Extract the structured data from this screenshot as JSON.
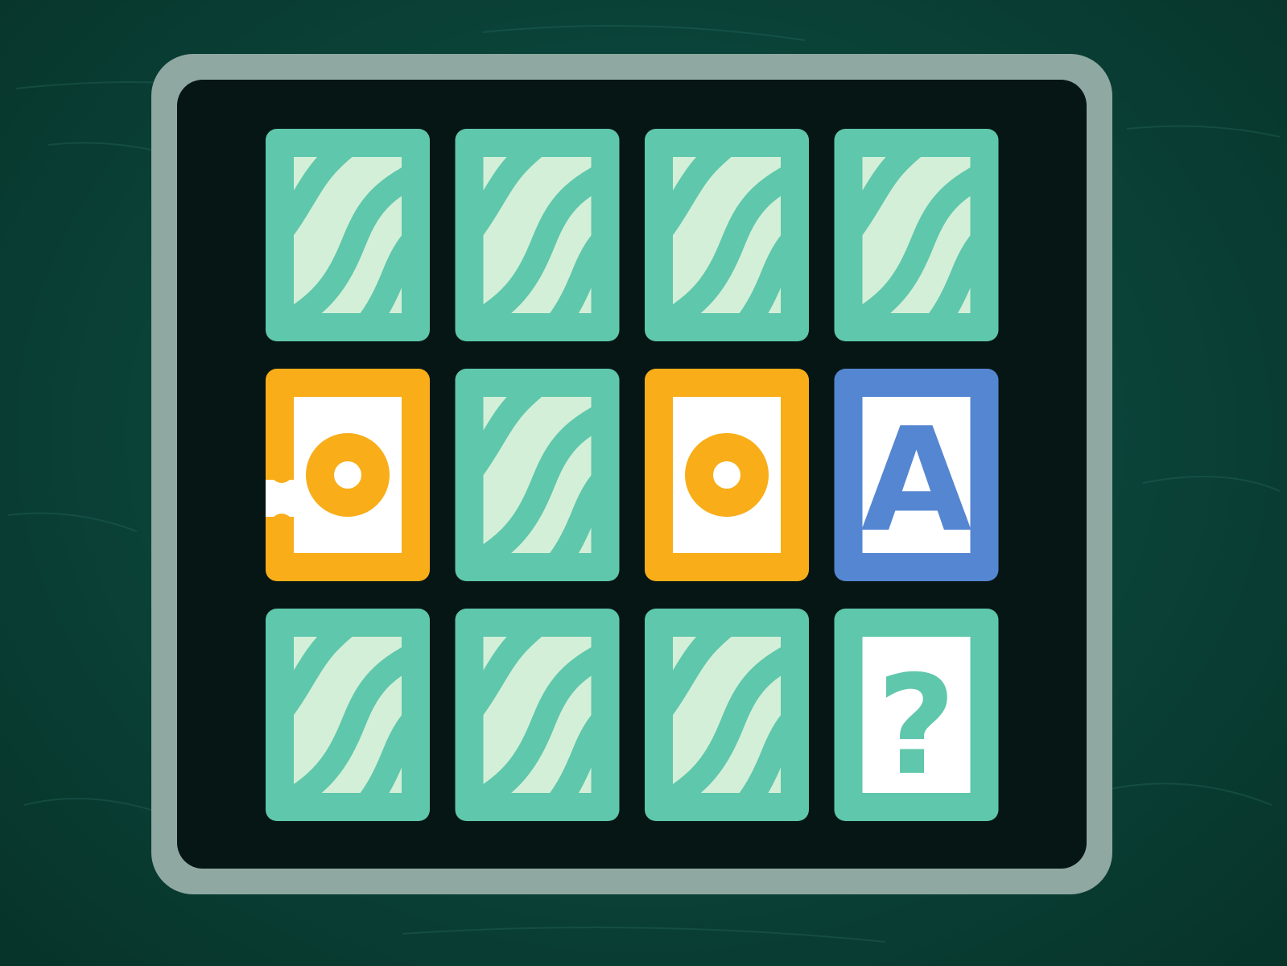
{
  "game": {
    "grid": {
      "rows": 3,
      "cols": 4
    },
    "colors": {
      "background": "#0b4a3f",
      "board": "#061614",
      "frame": "#8fa8a2",
      "card_back": "#5fc7ab",
      "card_back_pattern": "#d4efd8",
      "card_face_inner": "#ffffff",
      "orange": "#f8ad19",
      "blue": "#5586d1",
      "teal_symbol": "#5fc7ab"
    },
    "cards": [
      {
        "state": "face-down",
        "symbol": "wave-pattern-icon"
      },
      {
        "state": "face-down",
        "symbol": "wave-pattern-icon"
      },
      {
        "state": "face-down",
        "symbol": "wave-pattern-icon"
      },
      {
        "state": "face-down",
        "symbol": "wave-pattern-icon"
      },
      {
        "state": "face-up",
        "symbol": "ring-icon",
        "color": "orange",
        "torn": true
      },
      {
        "state": "face-down",
        "symbol": "wave-pattern-icon"
      },
      {
        "state": "face-up",
        "symbol": "ring-icon",
        "color": "orange",
        "torn": false
      },
      {
        "state": "face-up",
        "symbol": "letter",
        "label": "A",
        "color": "blue"
      },
      {
        "state": "face-down",
        "symbol": "wave-pattern-icon"
      },
      {
        "state": "face-down",
        "symbol": "wave-pattern-icon"
      },
      {
        "state": "face-down",
        "symbol": "wave-pattern-icon"
      },
      {
        "state": "face-up",
        "symbol": "question-mark-icon",
        "label": "?",
        "color": "teal_symbol"
      }
    ]
  }
}
